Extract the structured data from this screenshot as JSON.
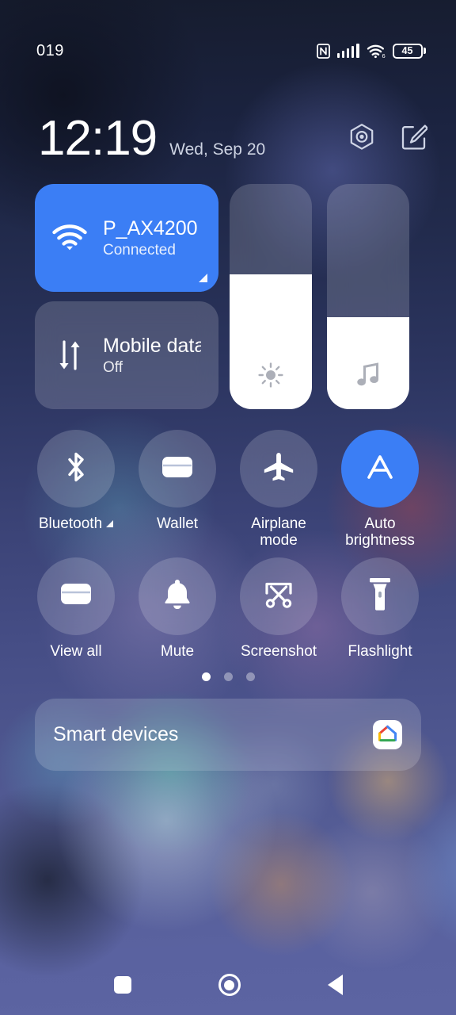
{
  "statusbar": {
    "left_text": "019",
    "icons": [
      "nfc-icon",
      "signal-bars-icon",
      "wifi-6-icon",
      "battery-icon"
    ],
    "battery_percent": "45",
    "wifi_generation": "6"
  },
  "header": {
    "time": "12:19",
    "date": "Wed, Sep 20",
    "actions": [
      {
        "name": "settings-hex-icon",
        "label": "Settings"
      },
      {
        "name": "edit-icon",
        "label": "Edit"
      }
    ]
  },
  "big_tiles": [
    {
      "icon": "wifi-icon",
      "title": "P_AX4200",
      "subtitle": "Connected",
      "state": "active",
      "has_expand_corner": true
    },
    {
      "icon": "mobile-data-icon",
      "title": "Mobile data",
      "subtitle": "Off",
      "state": "inactive",
      "has_expand_corner": false
    }
  ],
  "sliders": [
    {
      "name": "brightness-slider",
      "icon": "brightness-icon",
      "fill_percent": 60
    },
    {
      "name": "volume-slider",
      "icon": "music-note-icon",
      "fill_percent": 41
    }
  ],
  "toggles": [
    [
      {
        "label": "Bluetooth",
        "icon": "bluetooth-icon",
        "on": false,
        "expand": true
      },
      {
        "label": "Wallet",
        "icon": "wallet-icon",
        "on": false,
        "expand": false
      },
      {
        "label": "Airplane mode",
        "icon": "airplane-icon",
        "on": false,
        "expand": false
      },
      {
        "label": "Auto brightness",
        "icon": "auto-brightness-a-icon",
        "on": true,
        "expand": false
      }
    ],
    [
      {
        "label": "View all",
        "icon": "wallet-icon",
        "on": false,
        "expand": false
      },
      {
        "label": "Mute",
        "icon": "bell-icon",
        "on": false,
        "expand": false
      },
      {
        "label": "Screenshot",
        "icon": "scissors-icon",
        "on": false,
        "expand": false
      },
      {
        "label": "Flashlight",
        "icon": "flashlight-icon",
        "on": false,
        "expand": false
      }
    ]
  ],
  "pager": {
    "count": 3,
    "active_index": 0
  },
  "smart_devices": {
    "title": "Smart devices",
    "app_icon": "google-home-icon"
  },
  "navbar": [
    {
      "name": "recents-button",
      "icon": "square-icon"
    },
    {
      "name": "home-button",
      "icon": "circle-icon"
    },
    {
      "name": "back-button",
      "icon": "triangle-left-icon"
    }
  ],
  "colors": {
    "accent_blue": "#3b7ef5",
    "tile_inactive": "rgba(255,255,255,0.17)",
    "text_primary": "#ffffff",
    "text_secondary": "#cdd3e2"
  }
}
